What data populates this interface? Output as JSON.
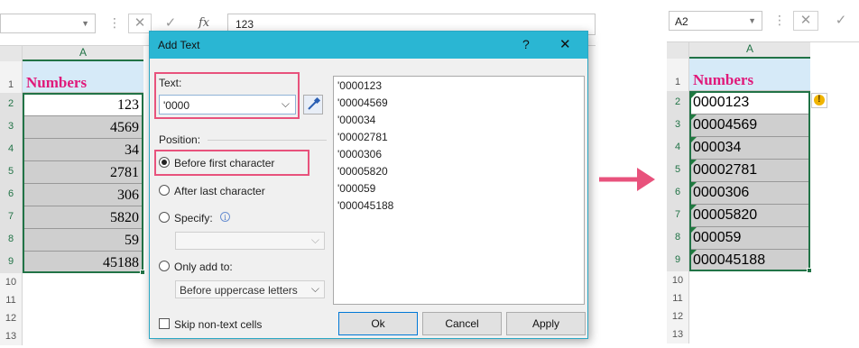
{
  "left_sheet": {
    "formula_value": "123",
    "fx_label": "fx",
    "cancel_glyph": "✕",
    "enter_glyph": "✓",
    "column_header": "A",
    "header_text": "Numbers",
    "header_color": "#e0197a",
    "row_numbers": [
      "1",
      "2",
      "3",
      "4",
      "5",
      "6",
      "7",
      "8",
      "9",
      "10",
      "11",
      "12",
      "13"
    ],
    "values": [
      "123",
      "4569",
      "34",
      "2781",
      "306",
      "5820",
      "59",
      "45188"
    ]
  },
  "dialog": {
    "title": "Add Text",
    "help_glyph": "?",
    "close_glyph": "✕",
    "text_label": "Text:",
    "text_value": "'0000",
    "position_label": "Position:",
    "options": {
      "before_first": "Before first character",
      "after_last": "After last character",
      "specify": "Specify:",
      "only_add_to": "Only add to:"
    },
    "only_add_value": "Before uppercase letters",
    "skip_label": "Skip non-text cells",
    "preview_lines": [
      "'0000123",
      "'00004569",
      "'000034",
      "'00002781",
      "'0000306",
      "'00005820",
      "'000059",
      "'000045188"
    ],
    "buttons": {
      "ok": "Ok",
      "cancel": "Cancel",
      "apply": "Apply"
    },
    "accent_color": "#2ab6d3",
    "highlight_color": "#e8527c"
  },
  "arrow_color": "#e8527c",
  "right_sheet": {
    "name_box": "A2",
    "cancel_glyph": "✕",
    "enter_glyph": "✓",
    "column_header": "A",
    "header_text": "Numbers",
    "row_numbers": [
      "1",
      "2",
      "3",
      "4",
      "5",
      "6",
      "7",
      "8",
      "9",
      "10",
      "11",
      "12",
      "13"
    ],
    "values": [
      "0000123",
      "00004569",
      "000034",
      "00002781",
      "0000306",
      "00005820",
      "000059",
      "000045188"
    ],
    "warning_glyph": "!"
  }
}
